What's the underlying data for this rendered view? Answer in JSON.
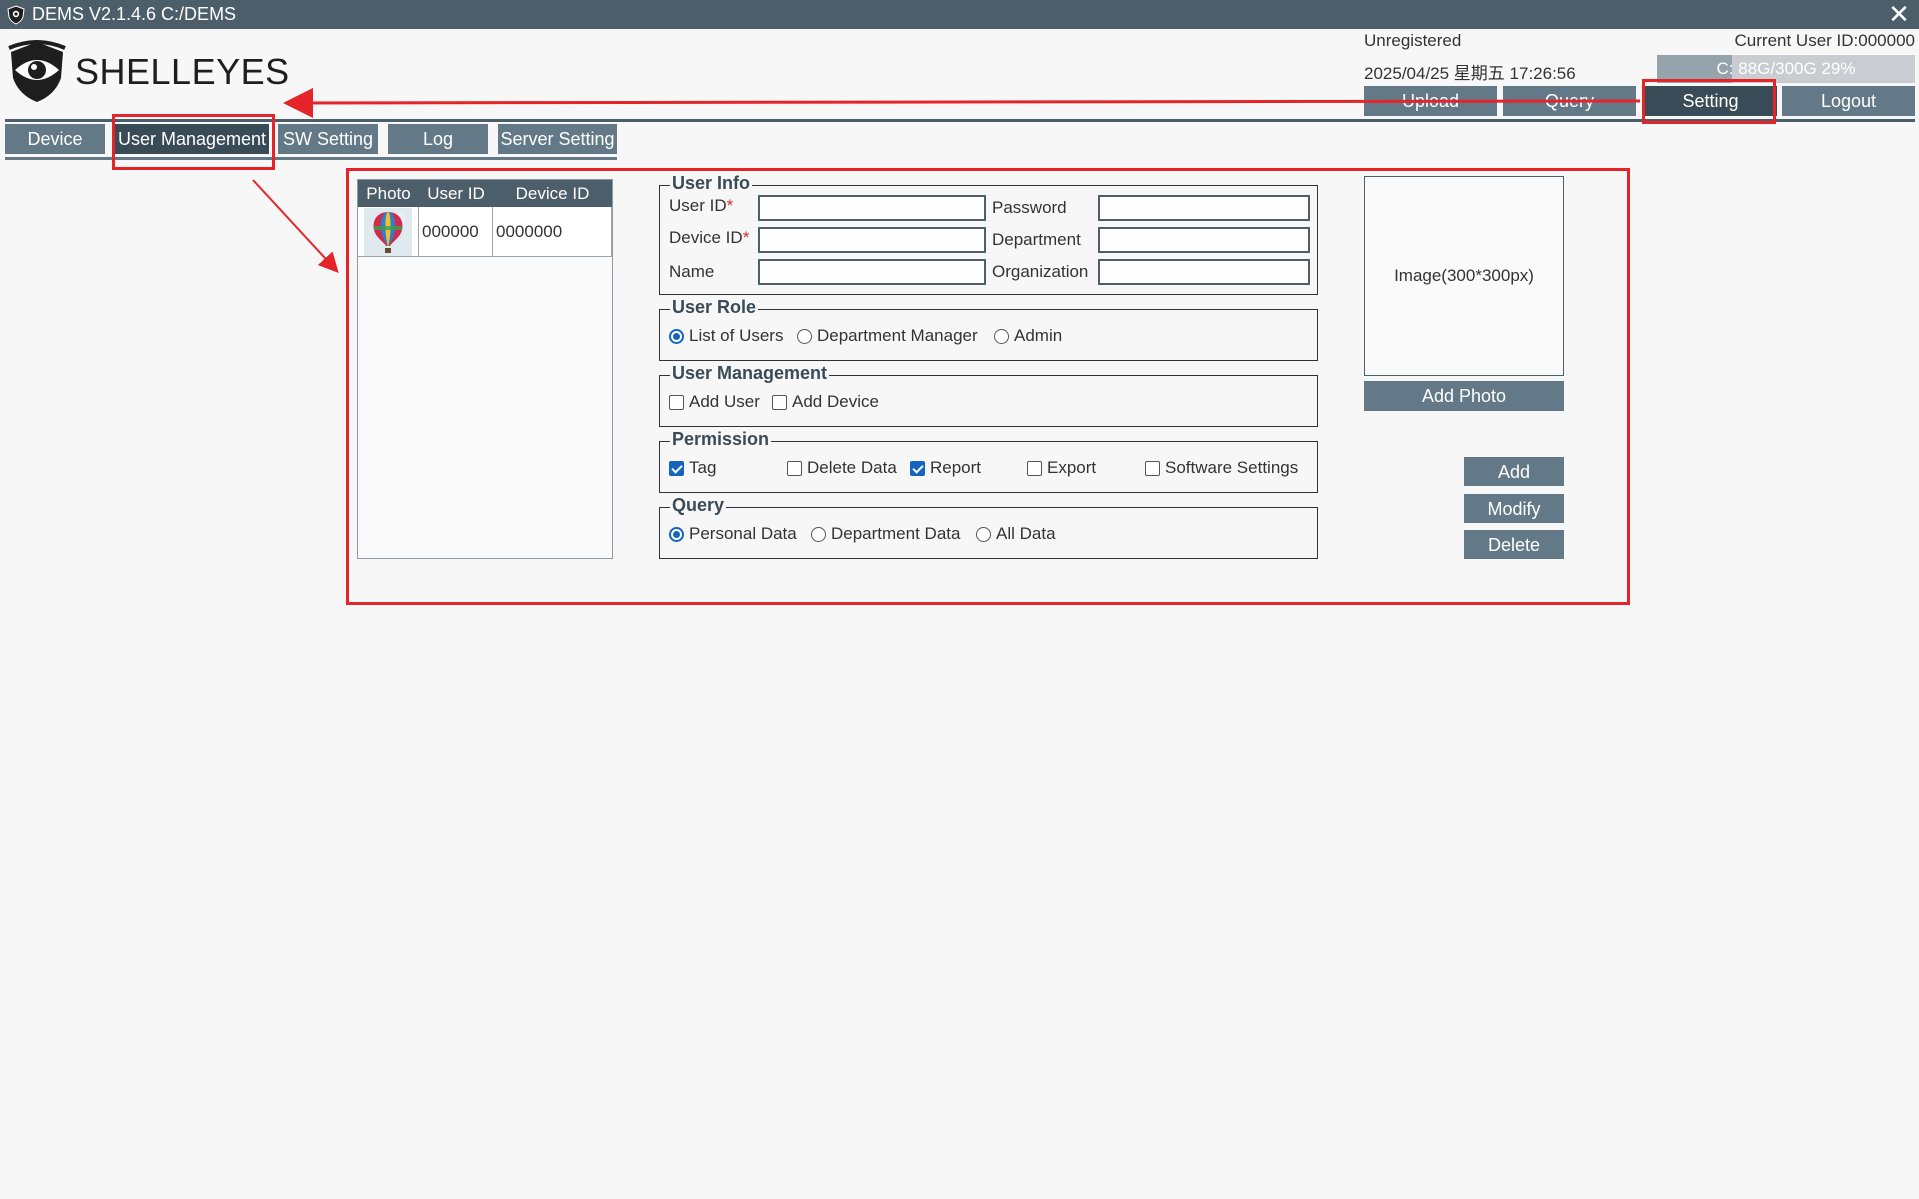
{
  "titlebar": {
    "title": "DEMS V2.1.4.6  C:/DEMS",
    "app_icon": "eye-shield-icon",
    "close_icon": "close-icon"
  },
  "logo": {
    "text": "SHELLEYES",
    "icon": "eye-shield-logo"
  },
  "status": {
    "registration": "Unregistered",
    "datetime": "2025/04/25 星期五 17:26:56",
    "current_user": "Current User ID:000000",
    "disk_text": "C: 88G/300G 29%",
    "disk_percent": 29
  },
  "top_nav": {
    "upload": "Upload",
    "query": "Query",
    "setting": "Setting",
    "logout": "Logout"
  },
  "tabs": {
    "device": "Device",
    "user_management": "User Management",
    "sw_setting": "SW Setting",
    "log": "Log",
    "server_setting": "Server Setting"
  },
  "user_list": {
    "headers": {
      "photo": "Photo",
      "user_id": "User ID",
      "device_id": "Device ID"
    },
    "rows": [
      {
        "user_id": "000000",
        "device_id": "0000000"
      }
    ]
  },
  "user_info": {
    "title": "User Info",
    "user_id_label": "User ID",
    "password_label": "Password",
    "device_id_label": "Device ID",
    "department_label": "Department",
    "name_label": "Name",
    "organization_label": "Organization",
    "required_mark": "*",
    "user_id_value": "",
    "password_value": "",
    "device_id_value": "",
    "department_value": "",
    "name_value": "",
    "organization_value": ""
  },
  "user_role": {
    "title": "User Role",
    "options": [
      "List of Users",
      "Department Manager",
      "Admin"
    ],
    "selected": "List of Users"
  },
  "user_management": {
    "title": "User Management",
    "add_user": "Add User",
    "add_device": "Add Device"
  },
  "permission": {
    "title": "Permission",
    "tag": "Tag",
    "delete_data": "Delete Data",
    "report": "Report",
    "export": "Export",
    "software_settings": "Software Settings"
  },
  "query": {
    "title": "Query",
    "options": [
      "Personal Data",
      "Department Data",
      "All Data"
    ],
    "selected": "Personal Data"
  },
  "image": {
    "placeholder": "Image(300*300px)",
    "add_photo": "Add Photo"
  },
  "actions": {
    "add": "Add",
    "modify": "Modify",
    "delete": "Delete"
  },
  "colors": {
    "header": "#4d5e6b",
    "button": "#637988",
    "active": "#3a4b58",
    "annotation": "#e5242a",
    "accent": "#1565c0"
  }
}
